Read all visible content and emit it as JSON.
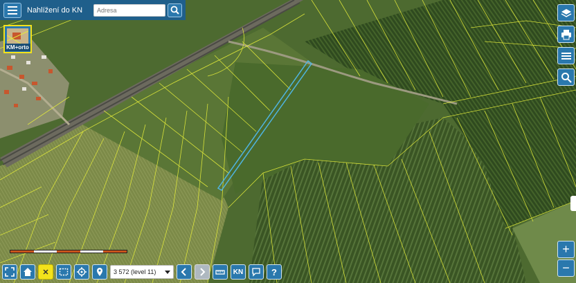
{
  "header": {
    "title": "Nahlížení do KN",
    "search_placeholder": "Adresa",
    "menu_icon": "hamburger-icon",
    "search_icon": "search-icon"
  },
  "layer_switch": {
    "label": "KM+orto"
  },
  "right_tools": [
    {
      "name": "layers-icon"
    },
    {
      "name": "print-icon"
    },
    {
      "name": "legend-icon"
    },
    {
      "name": "zoom-search-icon"
    }
  ],
  "zoom": {
    "in_label": "+",
    "out_label": "−"
  },
  "scale": {
    "level_label": "3 572 (level 11)"
  },
  "bottom_tools": {
    "kn_label": "KN",
    "help_label": "?",
    "close_label": "✕"
  },
  "colors": {
    "toolbar_blue": "#2a78ad",
    "header_blue": "#1f5f8b",
    "parcel_lines": "#e6ee3a",
    "highlight_parcel": "#4fb4e0",
    "active_button": "#f3e21b"
  }
}
